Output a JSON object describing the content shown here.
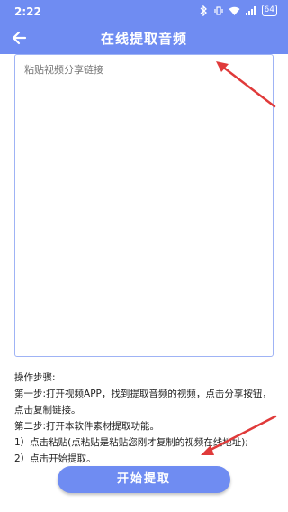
{
  "status": {
    "time": "2:22",
    "battery": "64"
  },
  "header": {
    "title": "在线提取音频"
  },
  "input": {
    "placeholder": "粘贴视频分享链接"
  },
  "instructions": {
    "heading": "操作步骤:",
    "step1": "第一步:打开视频APP，找到提取音频的视频，点击分享按钮，点击复制链接。",
    "step2": "第二步:打开本软件素材提取功能。",
    "sub1": "1）点击粘贴(点粘贴是粘贴您刚才复制的视频在线地址);",
    "sub2": "2）点击开始提取。"
  },
  "button": {
    "label": "开始提取"
  },
  "colors": {
    "accent": "#6f8cf2",
    "annotation": "#e03a3a"
  }
}
